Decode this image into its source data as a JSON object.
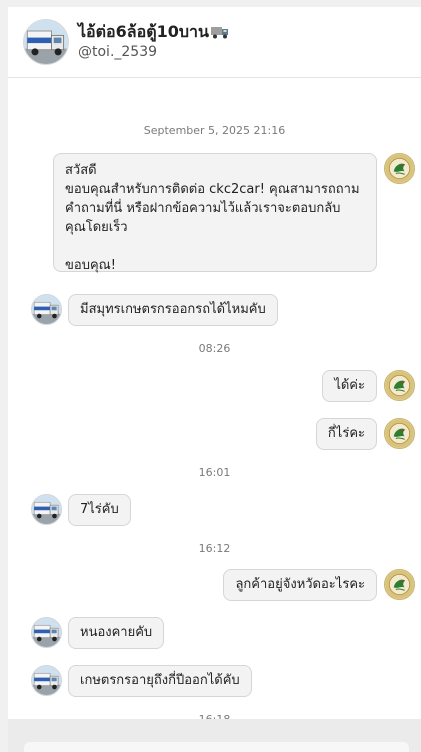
{
  "header": {
    "name": "ไอ้ต่อ6ล้อตู้10บาน",
    "name_emoji": "truck-emoji",
    "handle": "@toi._2539"
  },
  "messages": [
    {
      "type": "timestamp",
      "text": "September 5, 2025 21:16"
    },
    {
      "type": "outgoing",
      "avatar": "bot-logo",
      "text": "สวัสดี\nขอบคุณสำหรับการติดต่อ ckc2car! คุณสามารถถาม\nคำถามที่นี่ หรือฝากข้อความไว้แล้วเราจะตอบกลับ\nคุณโดยเร็ว\n\nขอบคุณ!"
    },
    {
      "type": "incoming",
      "avatar": "truck-avatar",
      "text": "มีสมุทรเกษตรกรออกรถได้ไหมคับ"
    },
    {
      "type": "timestamp",
      "text": "08:26"
    },
    {
      "type": "outgoing",
      "avatar": "bot-logo",
      "text": "ได้ค่ะ"
    },
    {
      "type": "outgoing",
      "avatar": "bot-logo",
      "text": "กี่ไร่คะ"
    },
    {
      "type": "timestamp",
      "text": "16:01"
    },
    {
      "type": "incoming",
      "avatar": "truck-avatar",
      "text": "7ไร่คับ"
    },
    {
      "type": "timestamp",
      "text": "16:12"
    },
    {
      "type": "outgoing",
      "avatar": "bot-logo",
      "text": "ลูกค้าอยู่จังหวัดอะไรคะ"
    },
    {
      "type": "incoming",
      "avatar": "truck-avatar",
      "text": "หนองคายคับ"
    },
    {
      "type": "incoming",
      "avatar": "truck-avatar",
      "text": "เกษตรกรอายุถึงกี่ปีออกได้คับ"
    },
    {
      "type": "timestamp",
      "text": "16:18"
    }
  ],
  "colors": {
    "bubble_bg": "#f3f3f3",
    "bubble_border": "#d6d6d6",
    "timestamp": "#7a7a7a"
  }
}
